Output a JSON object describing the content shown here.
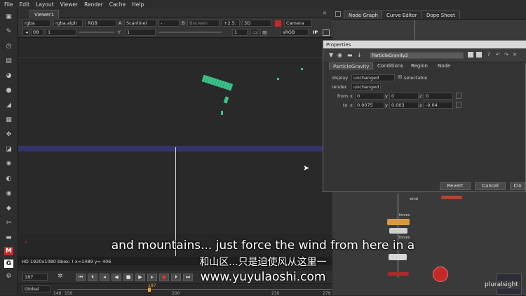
{
  "menu": [
    "File",
    "Edit",
    "Layout",
    "Viewer",
    "Render",
    "Cache",
    "Help"
  ],
  "viewer": {
    "tab": "Viewer1",
    "row1": {
      "channels": "rgba",
      "layer": "rgba.alph",
      "display": "RGB",
      "a_label": "A",
      "a_input": "Scanlinel",
      "dash": "-",
      "b_label": "B",
      "b_input": "Bscreen",
      "zoom": "+2.5:",
      "view": "3D",
      "camera": "Camera"
    },
    "row2": {
      "fstop": "f/8",
      "gain": "1",
      "y_label": "Y",
      "gamma": "1",
      "frame": "1",
      "colorspace": "sRGB",
      "ip": "IP"
    },
    "info": "HD 1920x1080 bbox: ! x=1489 y= 406",
    "timeline": {
      "frame": "187",
      "range_mode": "Global",
      "ticks": [
        "149",
        "150",
        "200",
        "230",
        "279"
      ],
      "current": "187"
    }
  },
  "nodegraph": {
    "tabs": [
      "Node Graph",
      "Curve Editor",
      "Dope Sheet"
    ]
  },
  "properties": {
    "title": "Properties",
    "node_name": "ParticleGravity2",
    "tabs": [
      "ParticleGravity",
      "Conditions",
      "Region",
      "Node"
    ],
    "display_label": "display",
    "display_value": "unchanged",
    "selectable_label": "selectable",
    "render_label": "render",
    "render_value": "unchanged",
    "from_label": "from",
    "from": {
      "x": "0",
      "y": "0",
      "z": "0"
    },
    "to_label": "to",
    "to": {
      "x": "0.0075",
      "y": "0.003",
      "z": "-0.04"
    },
    "axis": {
      "x": "x",
      "y": "y",
      "z": "z"
    },
    "buttons": {
      "revert": "Revert",
      "cancel": "Cancel",
      "close": "Clo"
    }
  },
  "nodes": {
    "wind_label": "wind",
    "particles_label": "forces",
    "particles2_label": "forces"
  },
  "subtitles": {
    "en": "and mountains... just force the wind from here in a",
    "zh": "和山区...只是迫使风从这里一",
    "url": "www.yuyulaoshi.com"
  },
  "watermark": "pluralsight",
  "colors": {
    "accent_red": "#c62828",
    "shard_green": "#3dc48a",
    "ground": "#34346a"
  }
}
